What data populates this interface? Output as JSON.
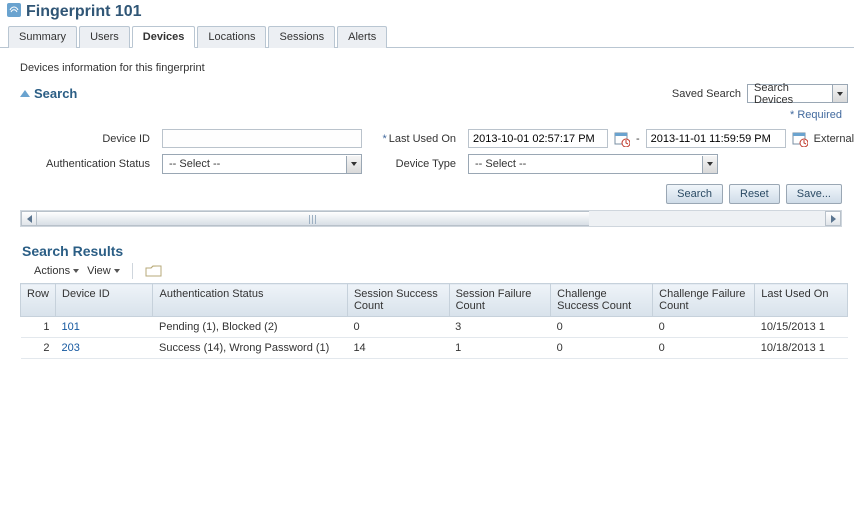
{
  "header": {
    "title": "Fingerprint 101"
  },
  "tabs": [
    {
      "id": "summary",
      "label": "Summary",
      "active": false
    },
    {
      "id": "users",
      "label": "Users",
      "active": false
    },
    {
      "id": "devices",
      "label": "Devices",
      "active": true
    },
    {
      "id": "locations",
      "label": "Locations",
      "active": false
    },
    {
      "id": "sessions",
      "label": "Sessions",
      "active": false
    },
    {
      "id": "alerts",
      "label": "Alerts",
      "active": false
    }
  ],
  "info_line": "Devices information for this fingerprint",
  "search": {
    "title": "Search",
    "saved_label": "Saved Search",
    "saved_value": "Search Devices",
    "required_note": "Required",
    "device_id_label": "Device ID",
    "device_id_value": "",
    "auth_status_label": "Authentication Status",
    "auth_status_value": "-- Select --",
    "last_used_label": "Last Used On",
    "last_used_from": "2013-10-01 02:57:17 PM",
    "last_used_to": "2013-11-01 11:59:59 PM",
    "range_separator": "-",
    "device_type_label": "Device Type",
    "device_type_value": "-- Select --",
    "external_device_label": "External Devic",
    "buttons": {
      "search": "Search",
      "reset": "Reset",
      "save": "Save..."
    }
  },
  "results": {
    "title": "Search Results",
    "toolbar": {
      "actions": "Actions",
      "view": "View"
    },
    "columns": {
      "row": "Row",
      "device_id": "Device ID",
      "auth_status": "Authentication Status",
      "sess_success": "Session Success Count",
      "sess_failure": "Session Failure Count",
      "chal_success": "Challenge Success Count",
      "chal_failure": "Challenge Failure Count",
      "last_used": "Last Used On"
    },
    "rows": [
      {
        "row": "1",
        "device_id": "101",
        "auth_status": "Pending (1), Blocked (2)",
        "sess_success": "0",
        "sess_failure": "3",
        "chal_success": "0",
        "chal_failure": "0",
        "last_used": "10/15/2013 1"
      },
      {
        "row": "2",
        "device_id": "203",
        "auth_status": "Success (14), Wrong Password (1)",
        "sess_success": "14",
        "sess_failure": "1",
        "chal_success": "0",
        "chal_failure": "0",
        "last_used": "10/18/2013 1"
      }
    ]
  }
}
